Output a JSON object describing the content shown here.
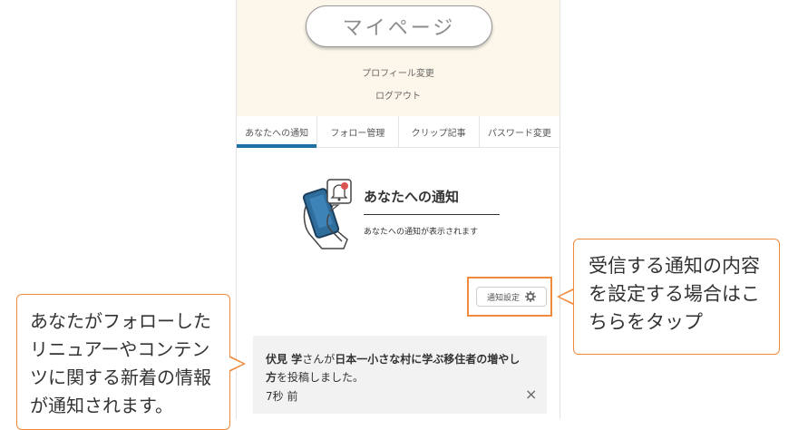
{
  "header": {
    "mypage_label": "マイページ",
    "profile_edit": "プロフィール変更",
    "logout": "ログアウト"
  },
  "tabs": [
    {
      "label": "あなたへの通知",
      "active": true
    },
    {
      "label": "フォロー管理",
      "active": false
    },
    {
      "label": "クリップ記事",
      "active": false
    },
    {
      "label": "パスワード変更",
      "active": false
    }
  ],
  "notifications": {
    "title": "あなたへの通知",
    "description": "あなたへの通知が表示されます",
    "settings_label": "通知設定",
    "settings_icon": "gear-icon",
    "item": {
      "actor": "伏見 学",
      "actor_suffix": "さんが",
      "article_title": "日本一小さな村に学ぶ移住者の増やし方",
      "action": "を投稿しました。",
      "time": "7秒 前",
      "close_icon": "×"
    }
  },
  "callouts": {
    "right": "受信する通知の内容を設定する場合はこちらをタップ",
    "left": "あなたがフォローしたリニュアーやコンテンツに関する新着の情報が通知されます。"
  },
  "colors": {
    "accent": "#1e6fa4",
    "callout_border": "#f08a3c",
    "profile_bg": "#fcf7ea",
    "card_bg": "#f2f2f2"
  }
}
